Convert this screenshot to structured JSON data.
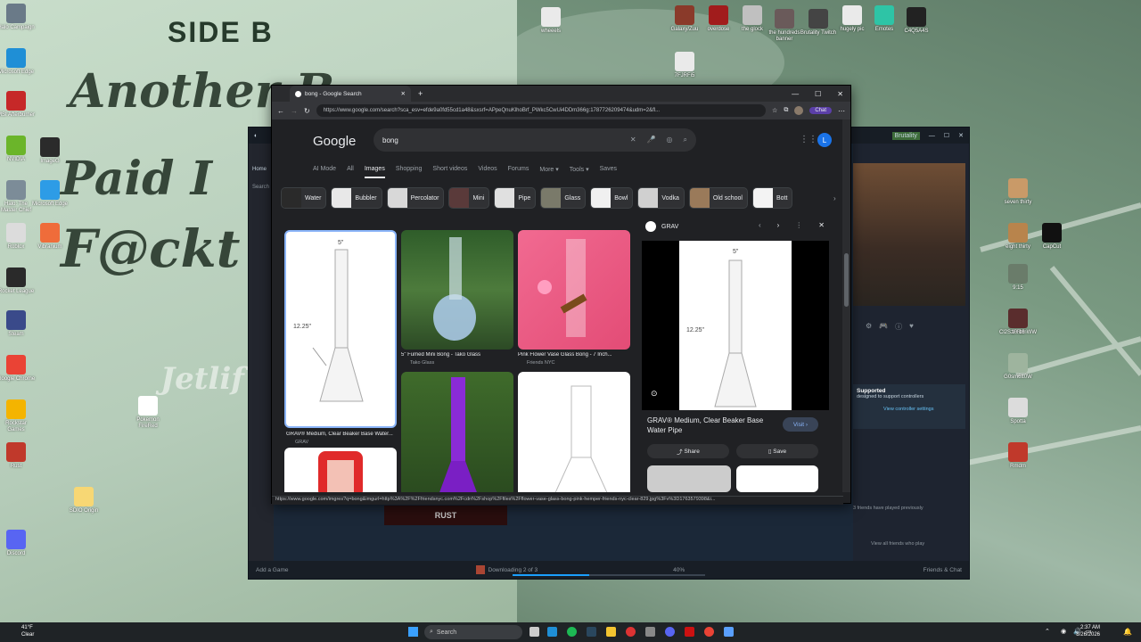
{
  "wallpaper": {
    "side_label": "SIDE B",
    "line1": "Another B",
    "line2": "Paid I",
    "line3": "F@ckt",
    "signature": "Jetlif"
  },
  "desktop_icons_left": [
    {
      "label": "Halo Campaign",
      "color": "#6a7a88"
    },
    {
      "label": "Microsoft Edge",
      "color": "#1f8fd6"
    },
    {
      "label": "MSI Afterburner",
      "color": "#c62828"
    },
    {
      "label": "NVIDIA",
      "color": "#6bb52a"
    },
    {
      "label": "Halo: The Master Chief",
      "color": "#7c8c98"
    },
    {
      "label": "Roblox",
      "color": "#dcdcdc"
    },
    {
      "label": "Rocket League",
      "color": "#2a2a2a"
    },
    {
      "label": "Steam",
      "color": "#3a4a8a"
    },
    {
      "label": "Google Chrome",
      "color": "#ea4335"
    },
    {
      "label": "Rockstar Games",
      "color": "#f4b400"
    },
    {
      "label": "Rust",
      "color": "#c0392b"
    },
    {
      "label": "Discord",
      "color": "#5865f2"
    }
  ],
  "desktop_icons_mid": [
    {
      "label": "ImageG",
      "color": "#2b2b2b"
    },
    {
      "label": "Microsoft Edge",
      "color": "#2d9ce6"
    },
    {
      "label": "Vibranium",
      "color": "#ef6c3a"
    },
    {
      "label": "Pokemon FireRed",
      "color": "#ffffff"
    },
    {
      "label": "SDIO Origin",
      "color": "#f7d774"
    }
  ],
  "desktop_icons_top": [
    {
      "label": "wheeels",
      "color": "#eaeaea"
    },
    {
      "label": "7FJRFi5",
      "color": "#eaeaea"
    },
    {
      "label": "Galaxy/Zuu",
      "color": "#8a3a2a"
    },
    {
      "label": "overdose",
      "color": "#a11c1c"
    },
    {
      "label": "the glock",
      "color": "#c0c0c0"
    },
    {
      "label": "the hundreds banner",
      "color": "#6a5a5a"
    },
    {
      "label": "Brutality Twitch",
      "color": "#444"
    },
    {
      "label": "hugely pic",
      "color": "#eaeaea"
    },
    {
      "label": "Emotes",
      "color": "#2ec4a6"
    },
    {
      "label": "C4Q5A4S",
      "color": "#222"
    }
  ],
  "desktop_icons_right": [
    {
      "label": "seven thirty",
      "color": "#c99a68"
    },
    {
      "label": "CapCut",
      "color": "#111"
    },
    {
      "label": "eight thirty",
      "color": "#b8844c"
    },
    {
      "label": "9:15",
      "color": "#6a7c6a"
    },
    {
      "label": "Cl2SzFRtmWW",
      "color": "#7e8d7e"
    },
    {
      "label": "10:16",
      "color": "#5a2d2d"
    },
    {
      "label": "G0sm6tt0W",
      "color": "#9eb49e"
    },
    {
      "label": "Spotta",
      "color": "#dcdcdc"
    },
    {
      "label": "Rmdm",
      "color": "#c0392b"
    }
  ],
  "steam": {
    "home": "Home",
    "search": "Search",
    "user": "Brutality",
    "supported_title": "Supported",
    "supported_text": "designed to support controllers",
    "controller_link": "View controller settings",
    "friends_played": "3 friends have played previously",
    "view_all_friends": "View all friends who play",
    "add_game": "Add a Game",
    "downloading": "Downloading 2 of 3",
    "download_pct": "40%",
    "download_fraction": 0.4,
    "friends_chat": "Friends & Chat",
    "game_banner": "RUST"
  },
  "chrome": {
    "tab_title": "bong - Google Search",
    "url": "https://www.google.com/search?sca_esv=efde9a0fd55cd1a48&sxsrf=APpeQnuKlhoBrf_PWkc5CwUi4DDm366g:1787726209474&udm=2&fl...",
    "chat_label": "Chat",
    "status_url": "https://www.google.com/imgres?q=bong&imgurl=http%3A%2F%2Ffriendsnyc.com%2Fcdn%2Fshop%2Ffiles%2Fflower-vase-glass-bong-pink-hemper-friends-nyc-clear-829.jpg%3Fv%3D1763579398&i..."
  },
  "google": {
    "logo": "Google",
    "query": "bong",
    "avatar_letter": "L",
    "tabs": [
      "AI Mode",
      "All",
      "Images",
      "Shopping",
      "Short videos",
      "Videos",
      "Forums",
      "More ▾",
      "Tools ▾",
      "Saves"
    ],
    "chips": [
      "Water",
      "Bubbler",
      "Percolator",
      "Mini",
      "Pipe",
      "Glass",
      "Bowl",
      "Vodka",
      "Old school",
      "Bott"
    ],
    "results": [
      {
        "caption": "GRAV® Medium, Clear Beaker Base Water...",
        "source": "GRAV",
        "size_label": "5\"",
        "height_label": "12.25\""
      },
      {
        "caption": "5\" Fumed Mini Bong - Tako Glass",
        "source": "Tako Glass"
      },
      {
        "caption": "Pink Flower Vase Glass Bong - 7 Inch...",
        "source": "Friends NYC"
      }
    ],
    "panel": {
      "source": "GRAV",
      "title": "GRAV® Medium, Clear Beaker Base Water Pipe",
      "visit": "Visit ›",
      "share": "Share",
      "save": "Save",
      "size_label": "5\"",
      "height_label": "12.25\""
    }
  },
  "taskbar": {
    "weather_temp": "41°F",
    "weather_cond": "Clear",
    "search": "Search",
    "time": "2:37 AM",
    "date": "8/26/2026"
  }
}
